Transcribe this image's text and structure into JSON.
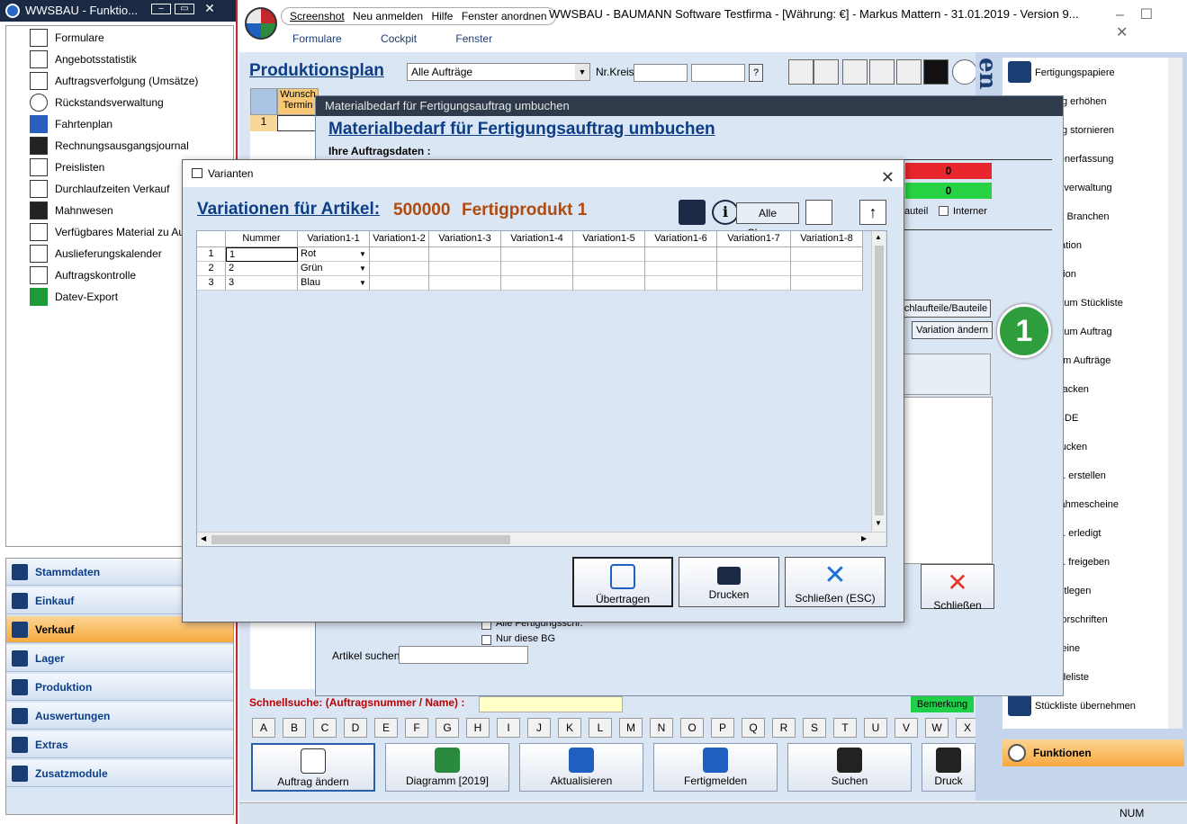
{
  "left_window": {
    "title": "WWSBAU - Funktio...",
    "tree_items": [
      "Formulare",
      "Angebotsstatistik",
      "Auftragsverfolgung (Umsätze)",
      "Rückstandsverwaltung",
      "Fahrtenplan",
      "Rechnungsausgangsjournal",
      "Preislisten",
      "Durchlaufzeiten Verkauf",
      "Mahnwesen",
      "Verfügbares Material zu Auftrag",
      "Auslieferungskalender",
      "Auftragskontrolle",
      "Datev-Export"
    ],
    "nav": [
      {
        "label": "Stammdaten"
      },
      {
        "label": "Einkauf"
      },
      {
        "label": "Verkauf"
      },
      {
        "label": "Lager"
      },
      {
        "label": "Produktion"
      },
      {
        "label": "Auswertungen"
      },
      {
        "label": "Extras"
      },
      {
        "label": "Zusatzmodule"
      }
    ]
  },
  "main_window": {
    "menu1": [
      "Screenshot",
      "Neu anmelden",
      "Hilfe",
      "Fenster anordnen"
    ],
    "title": "WWSBAU - BAUMANN Software Testfirma - [Währung: €] -   Markus Mattern - 31.01.2019 - Version 9...",
    "menu2": [
      "Formulare",
      "Cockpit",
      "Fenster"
    ],
    "page_title": "Produktionsplan",
    "filter_value": "Alle Aufträge",
    "nrkreis_label": "Nr.Kreis",
    "nrkreis_q": "?",
    "col_wunsch": "Wunsch Termin",
    "row1": "1",
    "schnellsuche": "Schnellsuche: (Auftragsnummer / Name) :",
    "bemerkung": "Bemerkung",
    "alphabet": [
      "A",
      "B",
      "C",
      "D",
      "E",
      "F",
      "G",
      "H",
      "I",
      "J",
      "K",
      "L",
      "M",
      "N",
      "O",
      "P",
      "Q",
      "R",
      "S",
      "T",
      "U",
      "V",
      "W",
      "X"
    ],
    "buttons": [
      "Auftrag ändern",
      "Diagramm [2019]",
      "Aktualisieren",
      "Fertigmelden",
      "Suchen",
      "Druck"
    ]
  },
  "right_panel": {
    "items": [
      "Fertigungspapiere",
      "vierung erhöhen",
      "vierung stornieren",
      "bsdatenerfassung",
      "standsverwaltung",
      "gswert Branchen",
      "kalkulation",
      "formation",
      "chiebaum Stückliste",
      "chiebaum Auftrag",
      "agramm Aufträge",
      "g verpacken",
      "szeit BDE",
      "ber drucken",
      "e Auftr. erstellen",
      "nentnahmescheine",
      "e Auftr. erledigt",
      "e Auftr. freigeben",
      "ahl festlegen",
      "ungsvorschriften",
      "enscheine",
      "nd-Ladeliste",
      "Stückliste übernehmen"
    ],
    "funktionen": "Funktionen",
    "side_letters": "en"
  },
  "status": {
    "num": "NUM"
  },
  "mat_window": {
    "title": "Materialbedarf für Fertigungsauftrag umbuchen",
    "heading": "Materialbedarf für Fertigungsauftrag umbuchen",
    "sub": "Ihre Auftragsdaten :",
    "red_value": "0",
    "green_value": "0",
    "bauteil": "auteil",
    "interner": "Interner",
    "btn_schlauf": "chlaufteile/Bauteile",
    "btn_variation": "Variation ändern",
    "btn_schliessen": "Schließen",
    "chk_alle": "Alle Fertigungsschr.",
    "chk_nur": "Nur diese BG",
    "artikel_suchen": "Artikel suchen:",
    "badge": "1"
  },
  "varianten_dialog": {
    "title": "Varianten",
    "heading": "Variationen für Artikel:",
    "article_no": "500000",
    "article_name": "Fertigprodukt 1",
    "alle_chargen": "Alle Chargen",
    "columns": [
      "Nummer",
      "Variation1-1",
      "Variation1-2",
      "Variation1-3",
      "Variation1-4",
      "Variation1-5",
      "Variation1-6",
      "Variation1-7",
      "Variation1-8"
    ],
    "rows": [
      {
        "rn": "1",
        "nummer": "1",
        "v1": "Rot"
      },
      {
        "rn": "2",
        "nummer": "2",
        "v1": "Grün"
      },
      {
        "rn": "3",
        "nummer": "3",
        "v1": "Blau"
      }
    ],
    "btn_uebertragen": "Übertragen",
    "btn_drucken": "Drucken",
    "btn_schliessen": "Schließen (ESC)"
  }
}
